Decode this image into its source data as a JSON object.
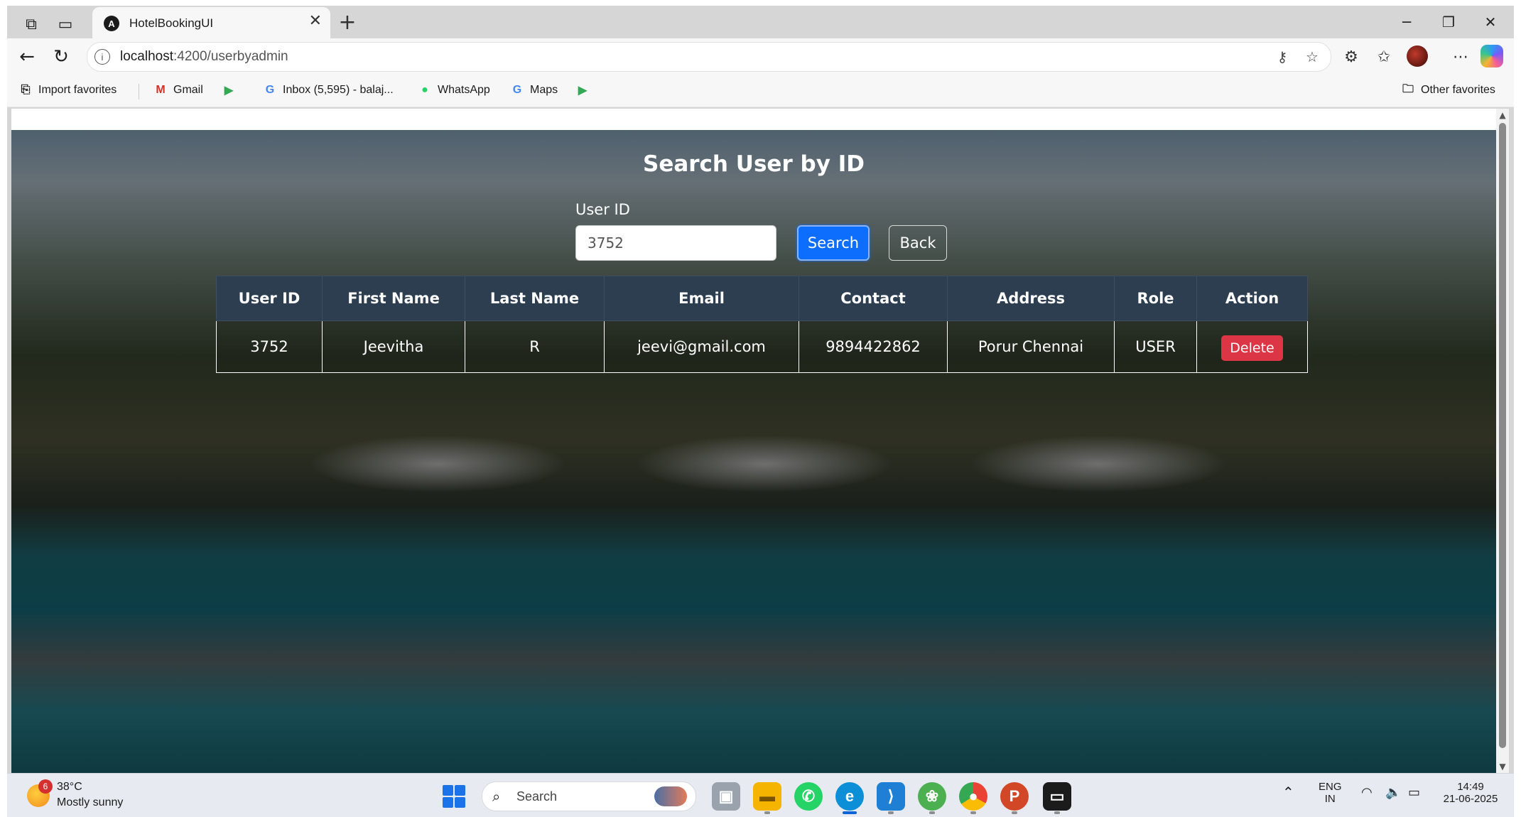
{
  "browser": {
    "tab_title": "HotelBookingUI",
    "tab_close": "✕",
    "new_tab": "+",
    "url_host": "localhost",
    "url_path": ":4200/userbyadmin",
    "bookmarks": [
      {
        "label": "Import favorites",
        "icon": "import-icon"
      },
      {
        "label": "Gmail",
        "icon": "gmail-icon"
      },
      {
        "label": "",
        "icon": "play-icon"
      },
      {
        "label": "Inbox (5,595) - balaj...",
        "icon": "google-icon"
      },
      {
        "label": "WhatsApp",
        "icon": "whatsapp-icon"
      },
      {
        "label": "Maps",
        "icon": "google-icon"
      },
      {
        "label": "",
        "icon": "play-icon"
      }
    ],
    "other_favorites": "Other favorites"
  },
  "page": {
    "title": "Search User by ID",
    "user_id_label": "User ID",
    "user_id_value": "3752",
    "search_label": "Search",
    "back_label": "Back",
    "table": {
      "headers": [
        "User ID",
        "First Name",
        "Last Name",
        "Email",
        "Contact",
        "Address",
        "Role",
        "Action"
      ],
      "rows": [
        {
          "user_id": "3752",
          "first_name": "Jeevitha",
          "last_name": "R",
          "email": "jeevi@gmail.com",
          "contact": "9894422862",
          "address": "Porur Chennai",
          "role": "USER",
          "action": "Delete"
        }
      ]
    }
  },
  "taskbar": {
    "weather_badge": "6",
    "temperature": "38°C",
    "weather_desc": "Mostly sunny",
    "search_placeholder": "Search",
    "language_line1": "ENG",
    "language_line2": "IN",
    "time": "14:49",
    "date": "21-06-2025"
  },
  "colors": {
    "primary_button": "#0d6efd",
    "danger_button": "#dc3545",
    "table_header": "#2c3e50"
  }
}
